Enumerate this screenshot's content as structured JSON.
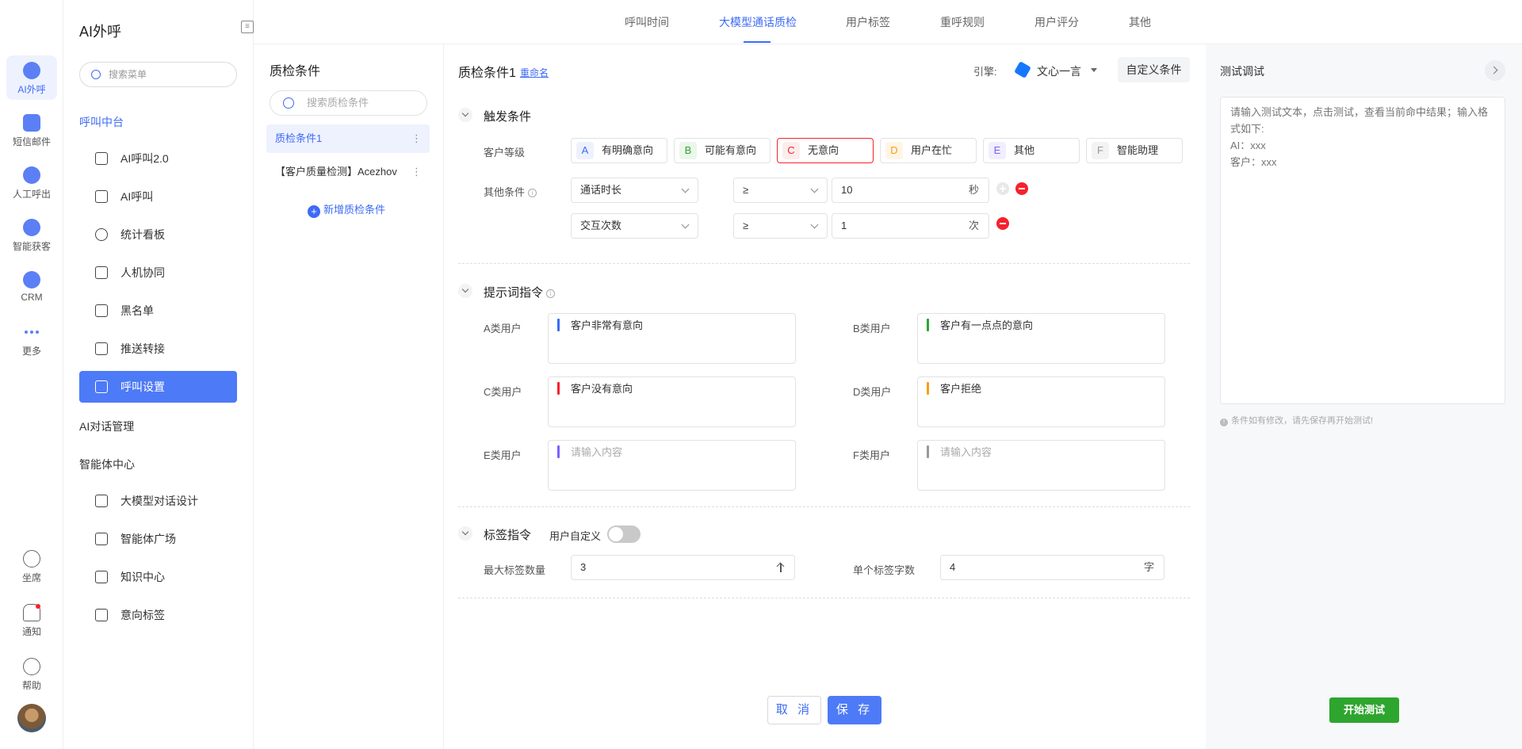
{
  "rail": {
    "items": [
      {
        "label": "AI外呼",
        "icon": "ai-call-icon"
      },
      {
        "label": "短信邮件",
        "icon": "message-icon"
      },
      {
        "label": "人工呼出",
        "icon": "agent-call-icon"
      },
      {
        "label": "智能获客",
        "icon": "acquire-icon"
      },
      {
        "label": "CRM",
        "icon": "crm-icon"
      },
      {
        "label": "更多",
        "icon": "more-icon"
      }
    ],
    "bottom": [
      {
        "label": "坐席",
        "icon": "headset-icon"
      },
      {
        "label": "通知",
        "icon": "bell-icon"
      },
      {
        "label": "帮助",
        "icon": "help-icon"
      }
    ]
  },
  "menu": {
    "title": "AI外呼",
    "search_placeholder": "搜索菜单",
    "section_call_center": "呼叫中台",
    "items_call": [
      {
        "label": "AI呼叫2.0",
        "icon": "phone-icon"
      },
      {
        "label": "AI呼叫",
        "icon": "phone-icon"
      },
      {
        "label": "统计看板",
        "icon": "pie-chart-icon"
      },
      {
        "label": "人机协同",
        "icon": "scan-user-icon"
      },
      {
        "label": "黑名单",
        "icon": "warning-icon"
      },
      {
        "label": "推送转接",
        "icon": "send-icon"
      },
      {
        "label": "呼叫设置",
        "icon": "sliders-icon"
      }
    ],
    "section_dialog": "AI对话管理",
    "section_agent": "智能体中心",
    "items_agent": [
      {
        "label": "大模型对话设计",
        "icon": "chat-design-icon"
      },
      {
        "label": "智能体广场",
        "icon": "store-icon"
      },
      {
        "label": "知识中心",
        "icon": "book-icon"
      },
      {
        "label": "意向标签",
        "icon": "tag-icon"
      }
    ]
  },
  "tabs": [
    "呼叫时间",
    "大模型通话质检",
    "用户标签",
    "重呼规则",
    "用户评分",
    "其他"
  ],
  "conditions": {
    "title": "质检条件",
    "search_placeholder": "搜索质检条件",
    "items": [
      "质检条件1",
      "【客户质量检测】Acezhov"
    ],
    "add_label": "新增质检条件"
  },
  "editor": {
    "title": "质检条件1",
    "rename": "重命名",
    "engine_label": "引擎:",
    "engine_name": "文心一言",
    "custom_btn": "自定义条件",
    "trigger": {
      "heading": "触发条件",
      "grade_label": "客户等级",
      "grades": [
        {
          "letter": "A",
          "label": "有明确意向",
          "color": "#3d6bf5",
          "bg": "#eef2ff"
        },
        {
          "letter": "B",
          "label": "可能有意向",
          "color": "#2ea52e",
          "bg": "#eaf7ea"
        },
        {
          "letter": "C",
          "label": "无意向",
          "color": "#f5222d",
          "bg": "#fdecec"
        },
        {
          "letter": "D",
          "label": "用户在忙",
          "color": "#fa9d14",
          "bg": "#fff5e6"
        },
        {
          "letter": "E",
          "label": "其他",
          "color": "#7b61ff",
          "bg": "#f1eeff"
        },
        {
          "letter": "F",
          "label": "智能助理",
          "color": "#999999",
          "bg": "#f3f3f3"
        }
      ],
      "other_label": "其他条件",
      "rows": [
        {
          "field": "通话时长",
          "op": "≥",
          "value": "10",
          "unit": "秒"
        },
        {
          "field": "交互次数",
          "op": "≥",
          "value": "1",
          "unit": "次"
        }
      ]
    },
    "prompt": {
      "heading": "提示词指令",
      "items": [
        {
          "label": "A类用户",
          "text": "客户非常有意向",
          "color": "#3d6bf5"
        },
        {
          "label": "B类用户",
          "text": "客户有一点点的意向",
          "color": "#2ea52e"
        },
        {
          "label": "C类用户",
          "text": "客户没有意向",
          "color": "#f5222d"
        },
        {
          "label": "D类用户",
          "text": "客户拒绝",
          "color": "#fa9d14"
        },
        {
          "label": "E类用户",
          "text": "请输入内容",
          "color": "#7b61ff"
        },
        {
          "label": "F类用户",
          "text": "请输入内容",
          "color": "#999999"
        }
      ]
    },
    "tag": {
      "heading": "标签指令",
      "custom_label": "用户自定义",
      "max_label": "最大标签数量",
      "max_value": "3",
      "single_label": "单个标签字数",
      "single_value": "4",
      "single_unit": "字"
    },
    "cancel": "取 消",
    "save": "保 存"
  },
  "test": {
    "title": "测试调试",
    "placeholder": "请输入测试文本，点击测试，查看当前命中结果；输入格式如下:\nAI：xxx\n客户：xxx",
    "hint": "条件如有修改，请先保存再开始测试!",
    "start": "开始测试"
  }
}
